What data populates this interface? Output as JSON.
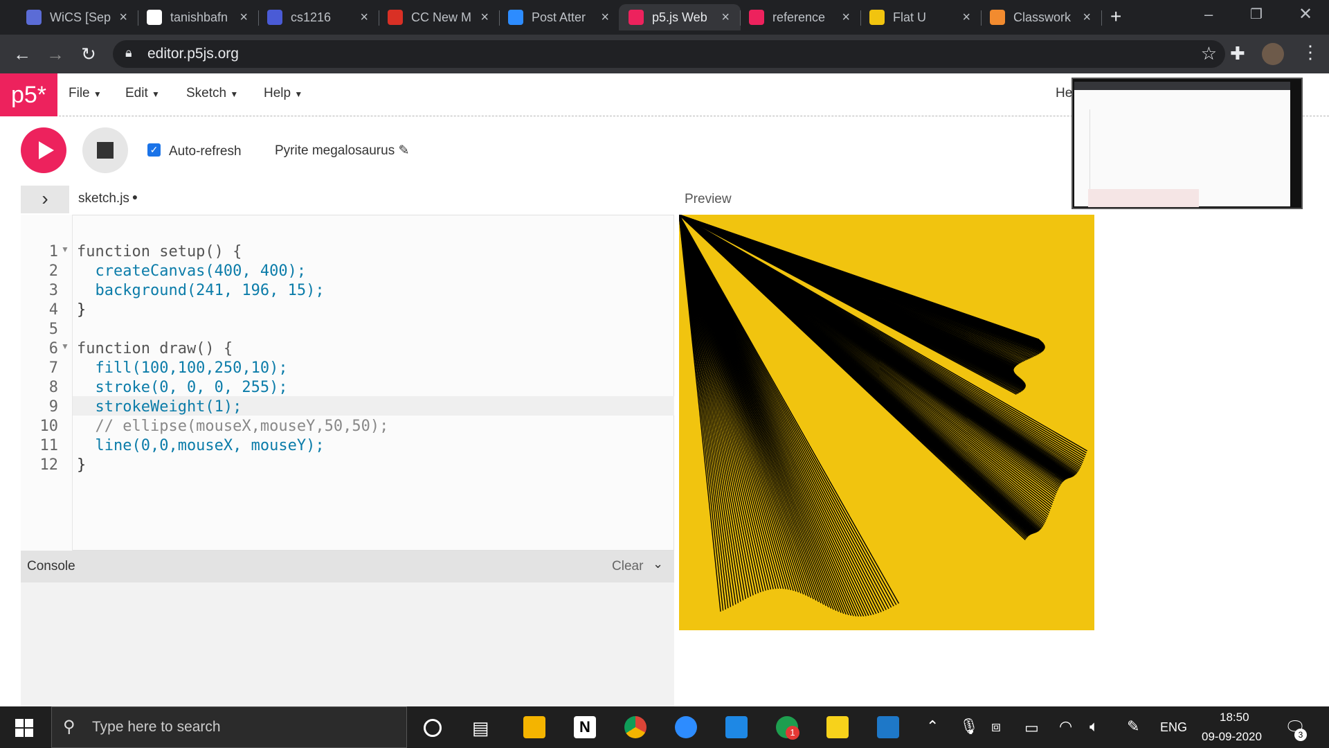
{
  "browser": {
    "tabs": [
      {
        "label": "WiCS [Sep",
        "icon": "c-circle-icon",
        "color": "#5b6cd6"
      },
      {
        "label": "tanishbafn",
        "icon": "github-icon",
        "color": "#ffffff"
      },
      {
        "label": "cs1216",
        "icon": "classroom-icon",
        "color": "#4a5bd6"
      },
      {
        "label": "CC New M",
        "icon": "gmail-icon",
        "color": "#d93025"
      },
      {
        "label": "Post Atter",
        "icon": "zoom-icon",
        "color": "#2d8cff"
      },
      {
        "label": "p5.js Web",
        "icon": "p5-star-icon",
        "color": "#ed225d"
      },
      {
        "label": "reference",
        "icon": "p5-star-icon",
        "color": "#ed225d"
      },
      {
        "label": "Flat U",
        "icon": "flatui-icon",
        "color": "#f1c40f"
      },
      {
        "label": "Classwork",
        "icon": "classwork-icon",
        "color": "#f28b2f"
      }
    ],
    "active_tab": 5,
    "url": "editor.p5js.org"
  },
  "p5": {
    "logo": "p5*",
    "menus": [
      "File",
      "Edit",
      "Sketch",
      "Help"
    ],
    "help_truncated": "He",
    "auto_refresh_label": "Auto-refresh",
    "auto_refresh_checked": true,
    "sketch_name": "Pyrite megalosaurus",
    "file_name": "sketch.js",
    "preview_label": "Preview",
    "console_label": "Console",
    "clear_label": "Clear",
    "canvas_color": "#f1c40f"
  },
  "code_lines": [
    "function setup() {",
    "  createCanvas(400, 400);",
    "  background(241, 196, 15);",
    "}",
    "",
    "function draw() {",
    "  fill(100,100,250,10);",
    "  stroke(0, 0, 0, 255);",
    "  strokeWeight(1);",
    "  // ellipse(mouseX,mouseY,50,50);",
    "  line(0,0,mouseX, mouseY);",
    "}"
  ],
  "taskbar": {
    "search_placeholder": "Type here to search",
    "language": "ENG",
    "time": "18:50",
    "date": "09-09-2020",
    "notification_count": "3",
    "whatsapp_badge": "1"
  }
}
